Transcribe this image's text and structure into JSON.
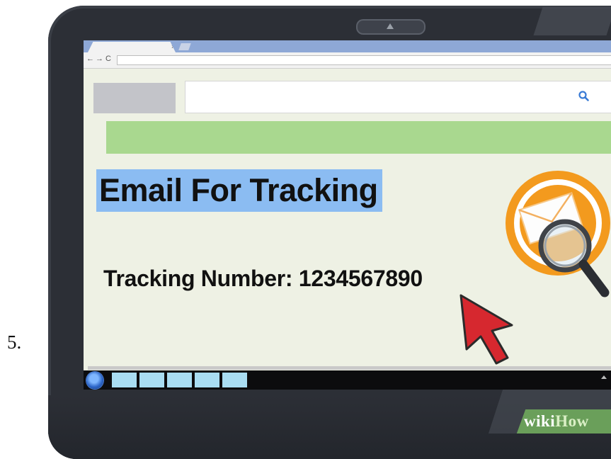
{
  "step": {
    "number": "5."
  },
  "browser": {
    "tab_close": "×",
    "nav_back": "←",
    "nav_forward": "→",
    "nav_reload": "C"
  },
  "content": {
    "heading": "Email For Tracking",
    "tracking_label": "Tracking Number:",
    "tracking_number": "1234567890"
  },
  "watermark": {
    "wiki": "wiki",
    "how": "How"
  },
  "colors": {
    "heading_highlight": "#8bbcf2",
    "banner_green": "#a9d88f",
    "mail_orange": "#f39a1e",
    "cursor_red": "#d6282f",
    "search_icon_blue": "#3a7bd5"
  },
  "icons": {
    "search": "search-icon",
    "mail": "envelope-icon",
    "magnifier": "magnifier-icon",
    "cursor": "cursor-arrow-icon",
    "start": "windows-start-icon"
  }
}
